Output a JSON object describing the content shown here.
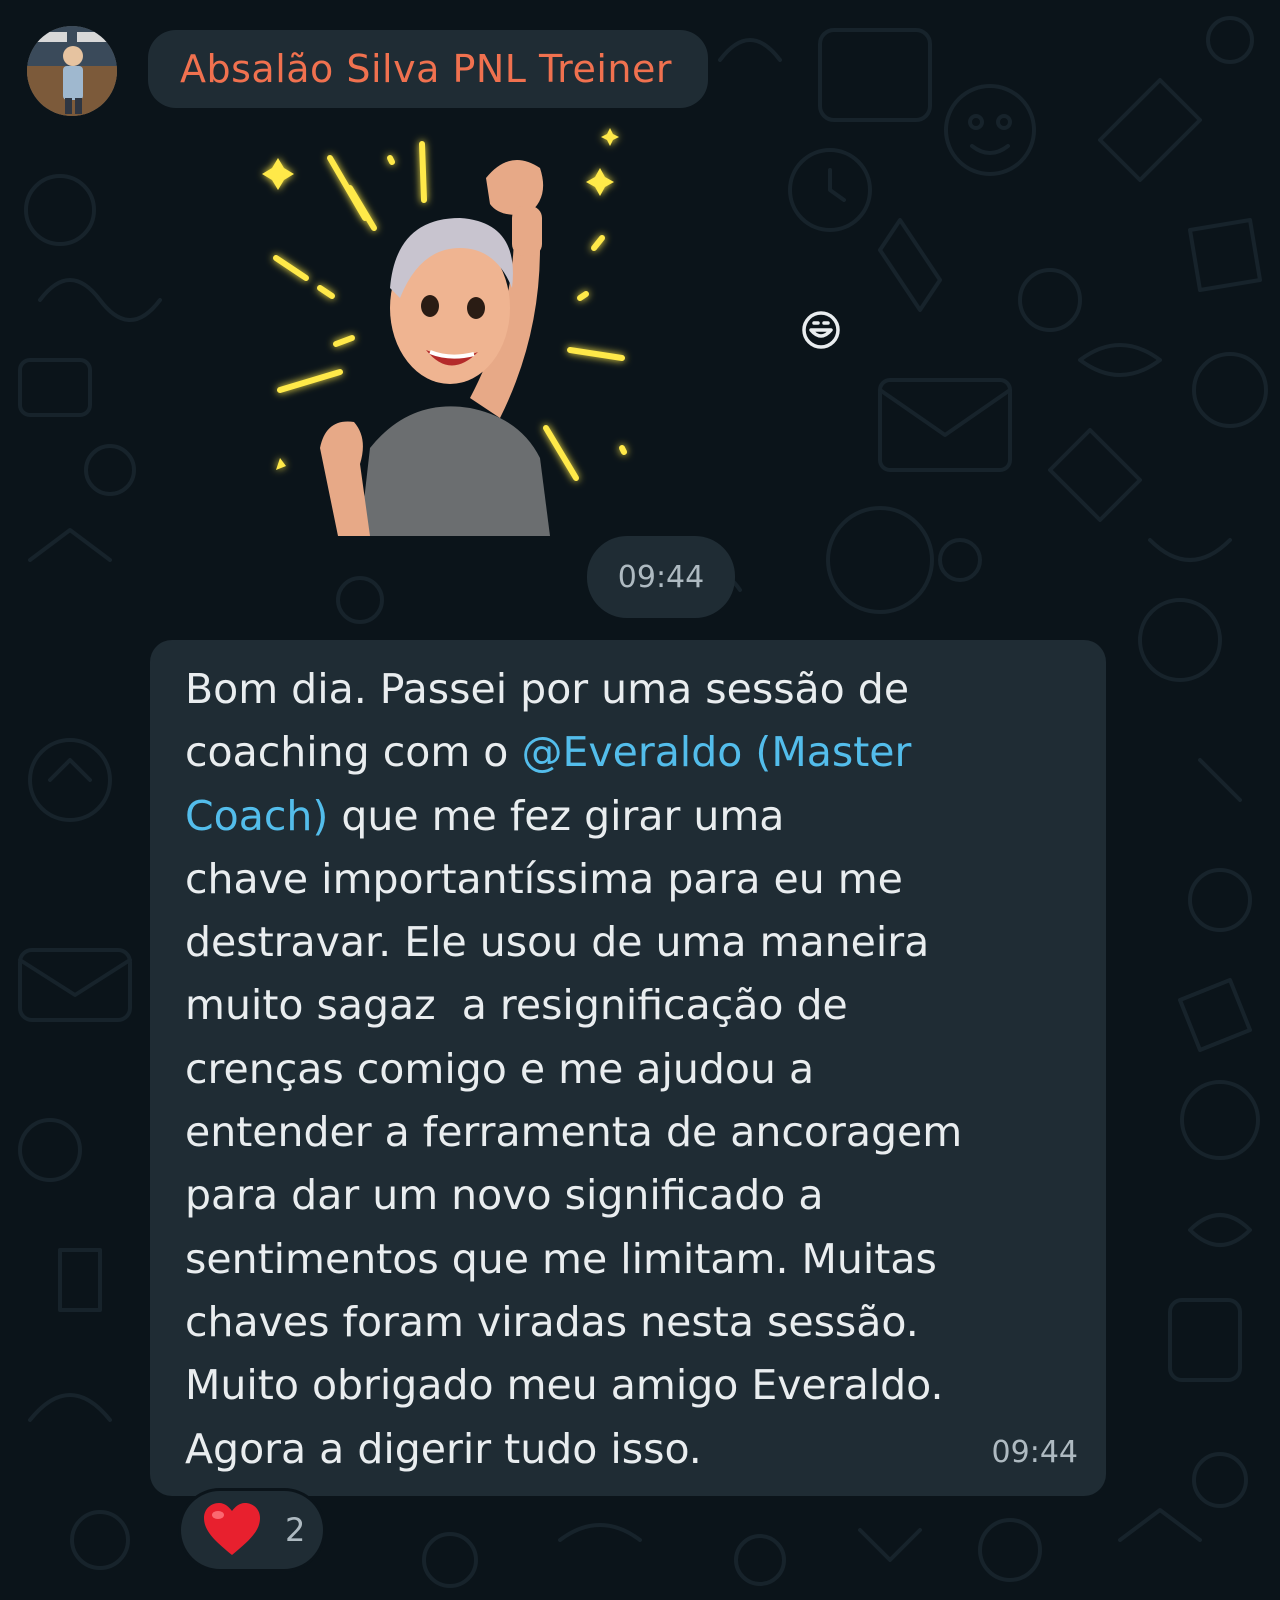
{
  "chat": {
    "sender_name": "Absalão Silva PNL Treiner",
    "sticker_time": "09:44",
    "message": {
      "lines": [
        [
          {
            "text": "Bom dia. Passei por uma sessão de"
          }
        ],
        [
          {
            "text": "coaching com o "
          },
          {
            "text": "@Everaldo (Master",
            "mention": true
          }
        ],
        [
          {
            "text": "Coach)",
            "mention": true
          },
          {
            "text": " que me fez girar uma"
          }
        ],
        [
          {
            "text": "chave importantíssima para eu me"
          }
        ],
        [
          {
            "text": "destravar. Ele usou de uma maneira"
          }
        ],
        [
          {
            "text": "muito sagaz  a resignificação de"
          }
        ],
        [
          {
            "text": "crenças comigo e me ajudou a"
          }
        ],
        [
          {
            "text": "entender a ferramenta de ancoragem"
          }
        ],
        [
          {
            "text": "para dar um novo significado a"
          }
        ],
        [
          {
            "text": "sentimentos que me limitam. Muitas"
          }
        ],
        [
          {
            "text": "chaves foram viradas nesta sessão."
          }
        ],
        [
          {
            "text": "Muito obrigado meu amigo Everaldo."
          }
        ],
        [
          {
            "text": "Agora a digerir tudo isso."
          }
        ]
      ],
      "time": "09:44"
    },
    "reaction": {
      "icon": "heart-icon",
      "count": "2"
    }
  },
  "colors": {
    "background": "#0b141a",
    "bubble": "#1f2c34",
    "sender_name": "#f0714f",
    "mention": "#53bdeb",
    "text": "#e9edef",
    "meta": "#aebac1",
    "heart": "#e8202e"
  }
}
